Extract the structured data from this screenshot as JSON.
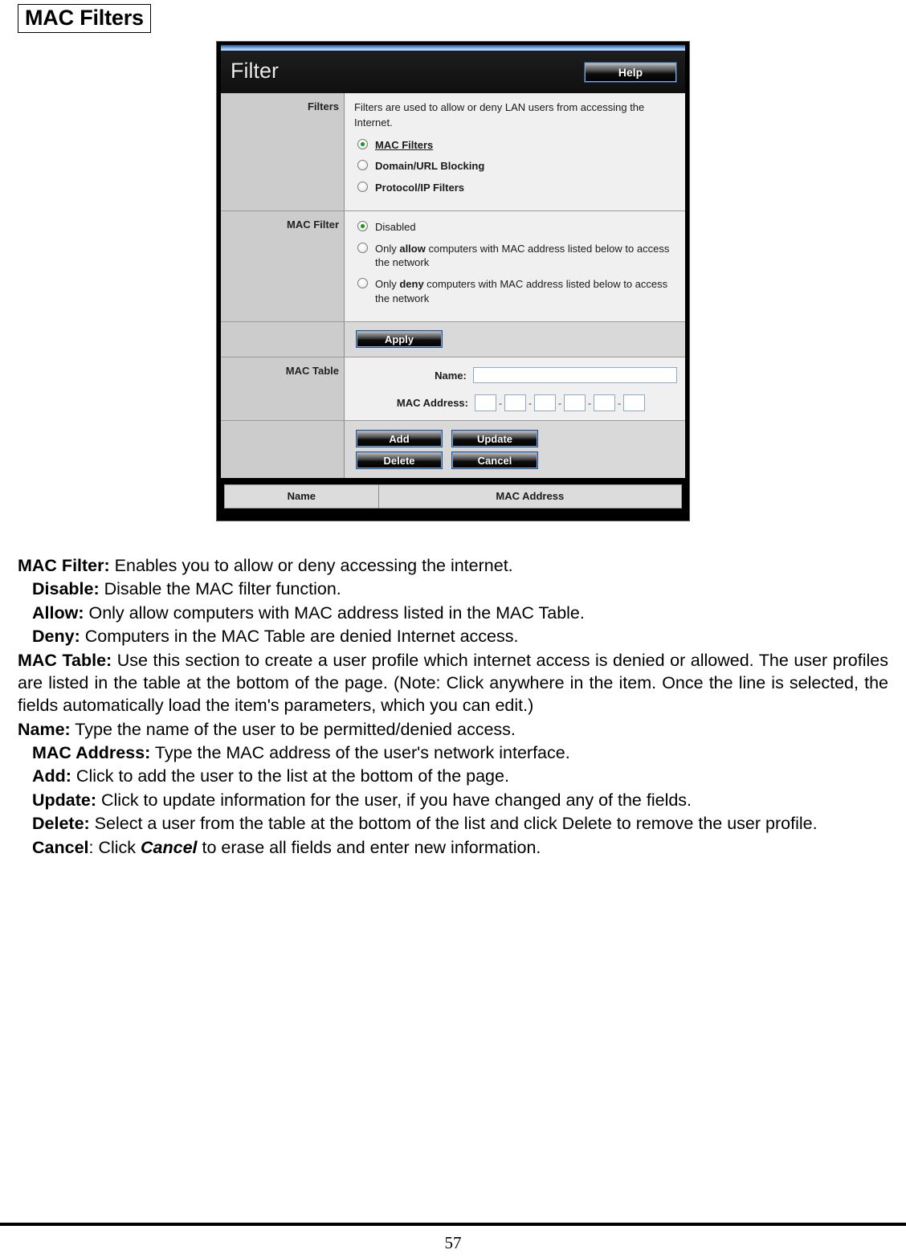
{
  "heading": "MAC Filters",
  "router_ui": {
    "app_title": "Filter",
    "help_label": "Help",
    "rows": {
      "filters": {
        "label": "Filters",
        "intro": "Filters are used to allow or deny LAN users from accessing the Internet.",
        "options": [
          {
            "label": "MAC Filters",
            "checked": true
          },
          {
            "label": "Domain/URL Blocking",
            "checked": false
          },
          {
            "label": "Protocol/IP Filters",
            "checked": false
          }
        ]
      },
      "mac_filter": {
        "label": "MAC Filter",
        "options": [
          {
            "pre": "Disabled",
            "bold": "",
            "post": "",
            "checked": true
          },
          {
            "pre": "Only ",
            "bold": "allow",
            "post": " computers with MAC address listed below to access the network",
            "checked": false
          },
          {
            "pre": "Only ",
            "bold": "deny",
            "post": " computers with MAC address listed below to access the network",
            "checked": false
          }
        ]
      },
      "apply": {
        "label": "Apply"
      },
      "mac_table": {
        "label": "MAC Table",
        "name_label": "Name:",
        "name_value": "",
        "mac_label": "MAC Address:",
        "mac_octets": [
          "",
          "",
          "",
          "",
          "",
          ""
        ],
        "separator": "-"
      },
      "actions": {
        "add": "Add",
        "update": "Update",
        "delete": "Delete",
        "cancel": "Cancel"
      }
    },
    "list_table": {
      "columns": [
        "Name",
        "MAC Address"
      ],
      "rows": []
    }
  },
  "body": {
    "mac_filter": {
      "term": "MAC Filter:",
      "text": " Enables you to allow or deny accessing the internet."
    },
    "disable": {
      "term": "Disable:",
      "text": " Disable the MAC filter function."
    },
    "allow": {
      "term": "Allow:",
      "text": " Only allow computers with MAC address listed in the MAC Table."
    },
    "deny": {
      "term": "Deny:",
      "text": " Computers in the MAC Table are denied Internet access."
    },
    "mac_table": {
      "term": "MAC Table:",
      "text": " Use this section to create a user profile which internet access is denied or allowed.  The user profiles are listed in the table at the bottom of the page.  (Note: Click anywhere in the item. Once the line is selected, the fields automatically load the item's parameters, which you can edit.)"
    },
    "name": {
      "term": "Name:",
      "text": " Type the name of the user to be permitted/denied access."
    },
    "mac_address": {
      "term": "MAC Address:",
      "text": " Type the MAC address of the user's network interface."
    },
    "add": {
      "term": "Add:",
      "text": " Click to add the user to the list at the bottom of the page."
    },
    "update": {
      "term": "Update:",
      "text": " Click to update information for the user, if you have changed any of the fields."
    },
    "delete": {
      "term": "Delete:",
      "text": " Select a user from the table at the bottom of the list and click Delete to remove the user profile."
    },
    "cancel": {
      "term": "Cancel",
      "mid": ": Click ",
      "emph": "Cancel",
      "post": " to erase all fields and enter new information."
    }
  },
  "footer": {
    "page_number": "57"
  }
}
